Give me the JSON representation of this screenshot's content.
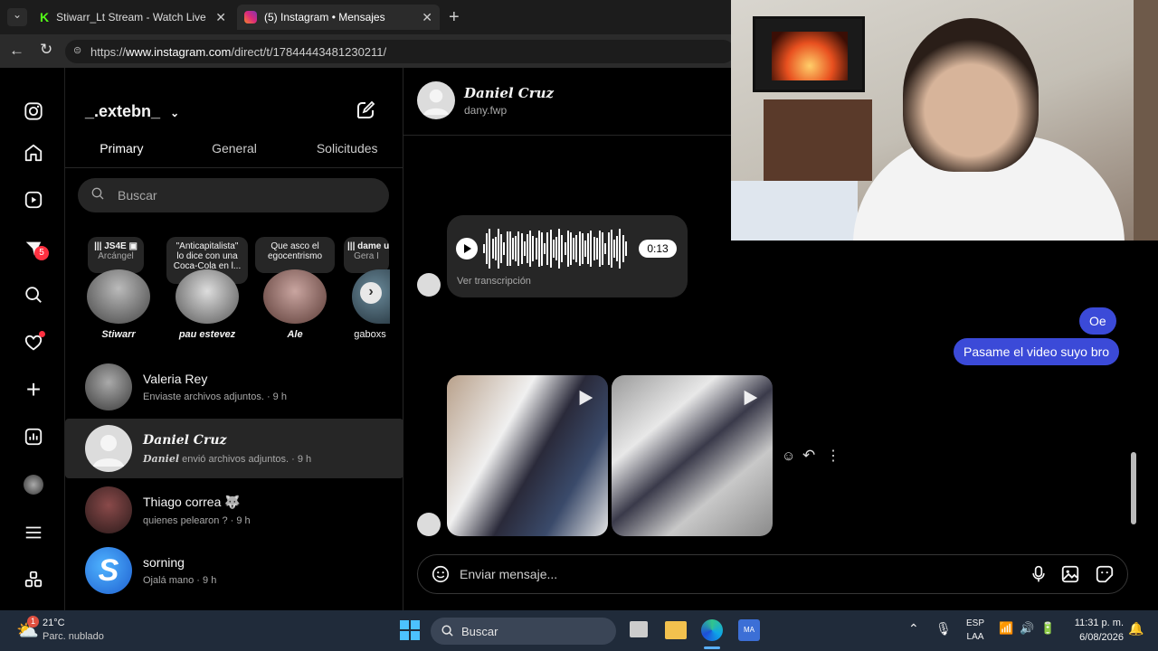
{
  "browser": {
    "tabs": [
      {
        "title": "Stiwarr_Lt Stream - Watch Live on",
        "icon": "kick-icon"
      },
      {
        "title": "(5) Instagram • Mensajes",
        "icon": "instagram-icon"
      }
    ],
    "url_prefix": "https://",
    "url_host": "www.instagram.com",
    "url_path": "/direct/t/17844443481230211/"
  },
  "nav": {
    "icons": [
      "instagram-logo-icon",
      "home-icon",
      "reels-icon",
      "messenger-icon",
      "search-icon",
      "heart-icon",
      "create-icon",
      "insights-icon",
      "profile-avatar",
      "menu-icon",
      "apps-icon"
    ],
    "messages_badge": "5"
  },
  "inbox": {
    "username": "_.extebn_",
    "tabs": [
      "Primary",
      "General",
      "Solicitudes"
    ],
    "search_placeholder": "Buscar",
    "notes": [
      {
        "line1": "||| JS4E ▣",
        "line2": "Arcángel"
      },
      {
        "line1": "\"Anticapitalista\"",
        "line2": "lo dice con una Coca-Cola en l..."
      },
      {
        "line1": "Que asco el",
        "line2": "egocentrismo"
      },
      {
        "line1": "||| dame u",
        "line2": "Gera I"
      }
    ],
    "stories": [
      "Stiwarr",
      "pau estevez",
      "Ale",
      "gaboxs"
    ],
    "conversations": [
      {
        "name": "Valeria Rey",
        "preview": "Enviaste archivos adjuntos. · 9 h"
      },
      {
        "name": "Daniel Cruz",
        "preview_name": "Daniel",
        "preview": "envió archivos adjuntos. · 9 h"
      },
      {
        "name": "Thiago correa 🐺",
        "preview": "quienes pelearon ? · 9 h"
      },
      {
        "name": "sorning",
        "preview": "Ojalá mano · 9 h"
      }
    ]
  },
  "chat": {
    "name": "Daniel Cruz",
    "handle": "dany.fwp",
    "audio_duration": "0:13",
    "audio_transcript_link": "Ver transcripción",
    "my_messages": [
      "Oe",
      "Pasame el video suyo bro"
    ],
    "composer_placeholder": "Enviar mensaje..."
  },
  "taskbar": {
    "weather_temp": "21°C",
    "weather_desc": "Parc. nublado",
    "weather_badge": "1",
    "search": "Buscar",
    "lang1": "ESP",
    "lang2": "LAA",
    "time": "11:31 p. m.",
    "date": "6/08/2026"
  },
  "colors": {
    "accent_blue": "#3b4ad8",
    "badge_red": "#ff3040",
    "dark_bg": "#000000",
    "panel": "#262626"
  }
}
